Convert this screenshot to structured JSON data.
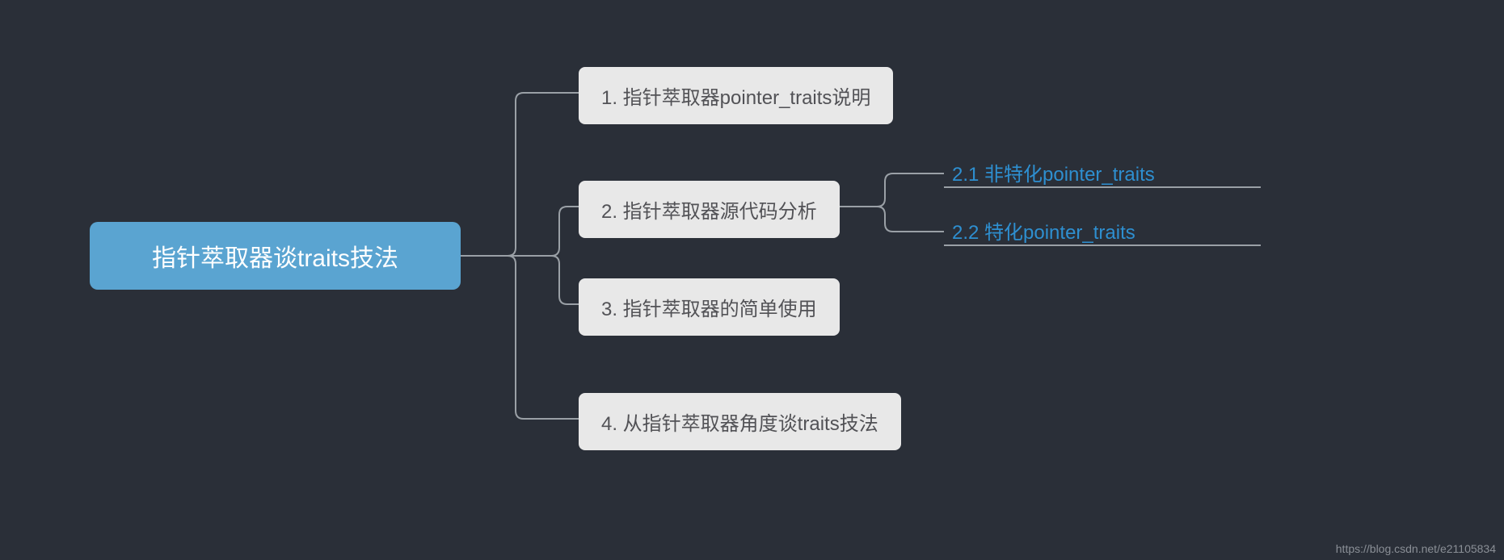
{
  "root": {
    "label": "指针萃取器谈traits技法"
  },
  "branches": [
    {
      "label": "1. 指针萃取器pointer_traits说明"
    },
    {
      "label": "2. 指针萃取器源代码分析"
    },
    {
      "label": "3. 指针萃取器的简单使用"
    },
    {
      "label": "4. 从指针萃取器角度谈traits技法"
    }
  ],
  "leaves": [
    {
      "label": "2.1 非特化pointer_traits"
    },
    {
      "label": "2.2 特化pointer_traits"
    }
  ],
  "watermark": "https://blog.csdn.net/e21105834",
  "colors": {
    "background": "#2a2f38",
    "root_bg": "#5aa4d1",
    "root_fg": "#ffffff",
    "branch_bg": "#e8e8e8",
    "branch_fg": "#525256",
    "leaf_fg": "#2e8fd0",
    "connector": "#9aa0a6"
  }
}
